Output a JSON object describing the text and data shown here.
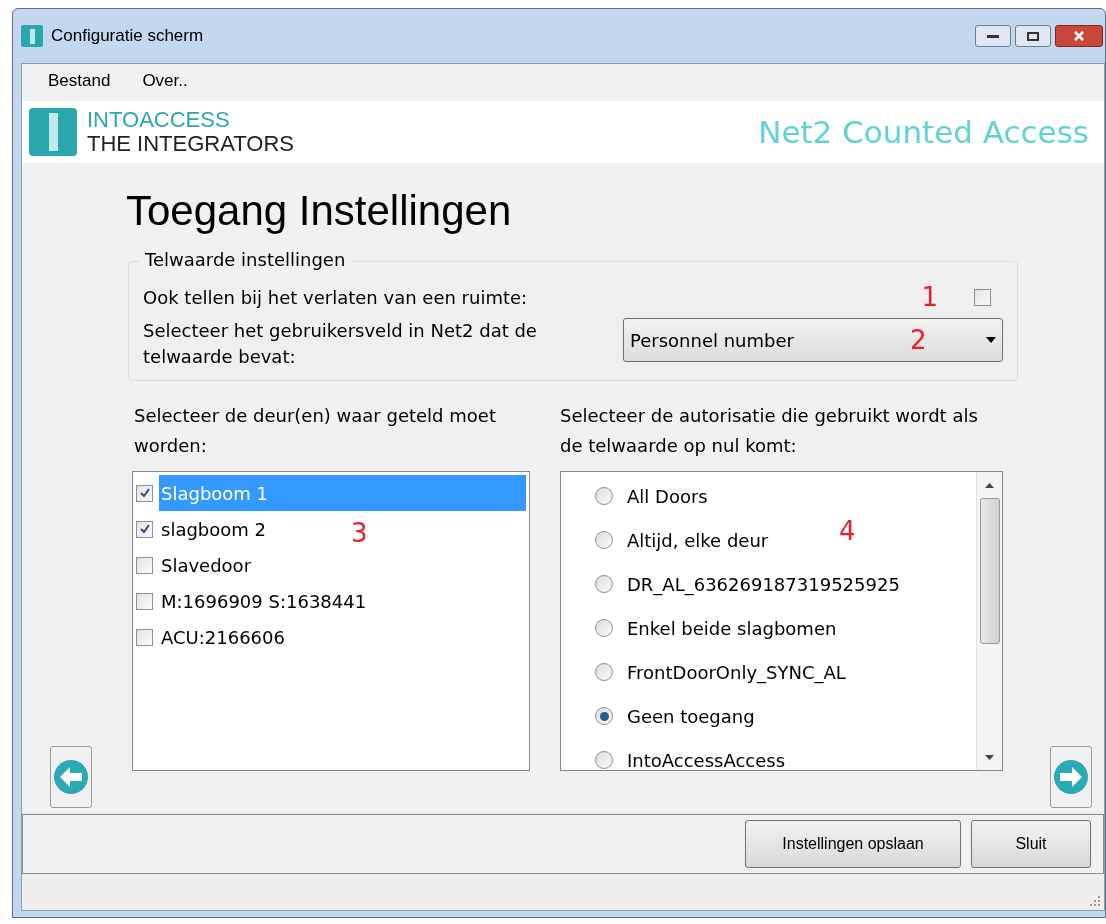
{
  "window": {
    "title": "Configuratie scherm"
  },
  "menu": [
    "Bestand",
    "Over.."
  ],
  "header": {
    "brand_top": "INTOACCESS",
    "brand_bottom": "THE INTEGRATORS",
    "product": "Net2 Counted Access"
  },
  "heading": "Toegang Instellingen",
  "group": {
    "title": "Telwaarde instellingen",
    "count_on_exit": {
      "label": "Ook tellen bij het verlaten van een ruimte:",
      "checked": false,
      "marker": "1"
    },
    "user_field": {
      "label": "Selecteer het gebruikersveld in Net2 dat de telwaarde bevat:",
      "value": "Personnel number",
      "marker": "2"
    }
  },
  "doors": {
    "label": "Selecteer de deur(en) waar geteld moet worden:",
    "marker": "3",
    "items": [
      {
        "label": "Slagboom 1",
        "checked": true,
        "selected": true
      },
      {
        "label": "slagboom 2",
        "checked": true,
        "selected": false
      },
      {
        "label": "Slavedoor",
        "checked": false,
        "selected": false
      },
      {
        "label": "M:1696909 S:1638441",
        "checked": false,
        "selected": false
      },
      {
        "label": "ACU:2166606",
        "checked": false,
        "selected": false
      }
    ]
  },
  "authorisations": {
    "label": "Selecteer de autorisatie die gebruikt wordt als de telwaarde op nul komt:",
    "marker": "4",
    "items": [
      {
        "label": "All Doors",
        "selected": false
      },
      {
        "label": "Altijd, elke deur",
        "selected": false
      },
      {
        "label": "DR_AL_636269187319525925",
        "selected": false
      },
      {
        "label": "Enkel beide slagbomen",
        "selected": false
      },
      {
        "label": "FrontDoorOnly_SYNC_AL",
        "selected": false
      },
      {
        "label": "Geen toegang",
        "selected": true
      },
      {
        "label": "IntoAccessAccess",
        "selected": false
      }
    ]
  },
  "buttons": [
    "Instellingen opslaan",
    "Sluit"
  ]
}
